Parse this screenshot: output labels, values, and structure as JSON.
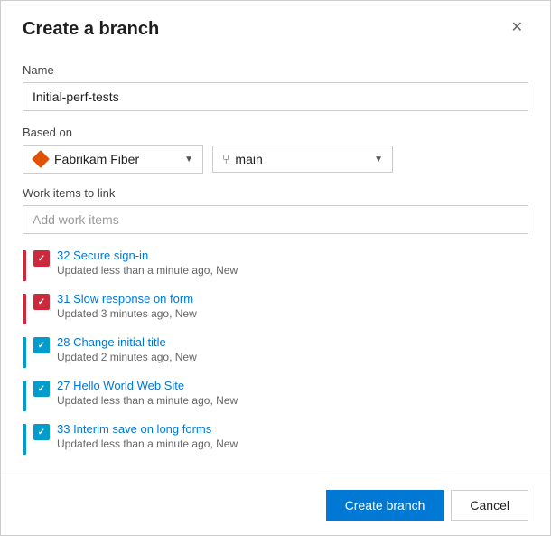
{
  "dialog": {
    "title": "Create a branch",
    "close_label": "✕"
  },
  "name_field": {
    "label": "Name",
    "value": "Initial-perf-tests"
  },
  "based_on": {
    "label": "Based on",
    "repo": {
      "name": "Fabrikam Fiber"
    },
    "branch": {
      "name": "main"
    }
  },
  "work_items": {
    "label": "Work items to link",
    "placeholder": "Add work items",
    "items": [
      {
        "id": "32",
        "title": "Secure sign-in",
        "meta": "Updated less than a minute ago, New",
        "color_type": "red"
      },
      {
        "id": "31",
        "title": "Slow response on form",
        "meta": "Updated 3 minutes ago, New",
        "color_type": "red"
      },
      {
        "id": "28",
        "title": "Change initial title",
        "meta": "Updated 2 minutes ago, New",
        "color_type": "blue"
      },
      {
        "id": "27",
        "title": "Hello World Web Site",
        "meta": "Updated less than a minute ago, New",
        "color_type": "blue"
      },
      {
        "id": "33",
        "title": "Interim save on long forms",
        "meta": "Updated less than a minute ago, New",
        "color_type": "blue"
      }
    ]
  },
  "footer": {
    "create_label": "Create branch",
    "cancel_label": "Cancel"
  }
}
